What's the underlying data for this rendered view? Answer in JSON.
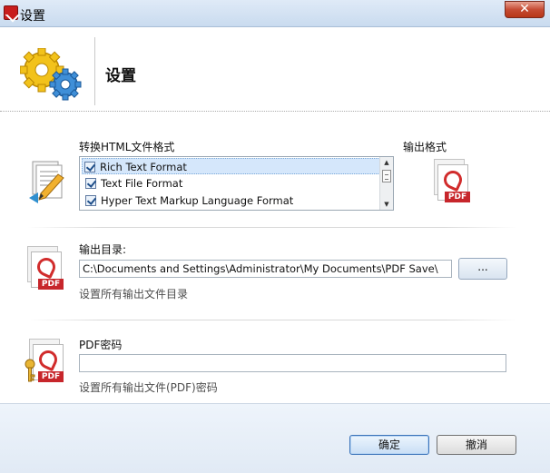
{
  "window": {
    "title": "设置",
    "close_label": "✕"
  },
  "header": {
    "title": "设置"
  },
  "format_section": {
    "label": "转换HTML文件格式",
    "items": [
      {
        "label": "Rich Text Format",
        "checked": true,
        "selected": true
      },
      {
        "label": "Text File Format",
        "checked": true,
        "selected": false
      },
      {
        "label": "Hyper Text Markup Language Format",
        "checked": true,
        "selected": false
      }
    ],
    "output_format_label": "输出格式"
  },
  "output_dir": {
    "label": "输出目录:",
    "value": "C:\\Documents and Settings\\Administrator\\My Documents\\PDF Save\\",
    "browse_label": "...",
    "hint": "设置所有输出文件目录"
  },
  "password": {
    "label": "PDF密码",
    "value": "",
    "hint": "设置所有输出文件(PDF)密码"
  },
  "pdf_badge": "PDF",
  "buttons": {
    "ok": "确定",
    "cancel": "撤消"
  },
  "colors": {
    "accent": "#3b73b9",
    "pdf_red": "#c7262b",
    "titlebar": "#c9dbef",
    "close": "#c64c34"
  }
}
